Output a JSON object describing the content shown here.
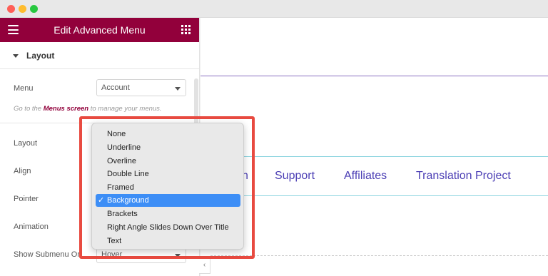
{
  "panel": {
    "title": "Edit Advanced Menu",
    "section": "Layout",
    "menu_label": "Menu",
    "menu_value": "Account",
    "hint_prefix": "Go to the ",
    "hint_link": "Menus screen",
    "hint_suffix": " to manage your menus.",
    "rows": [
      "Layout",
      "Align",
      "Pointer",
      "Animation",
      "Show Submenu On"
    ],
    "submenu_value": "Hover"
  },
  "canvas": {
    "menu_items": [
      "n",
      "Support",
      "Affiliates",
      "Translation Project"
    ]
  },
  "dropdown": {
    "options": [
      "None",
      "Underline",
      "Overline",
      "Double Line",
      "Framed",
      "Background",
      "Brackets",
      "Right Angle Slides Down Over Title",
      "Text"
    ],
    "selected": "Background",
    "check": "✓"
  },
  "colors": {
    "brand": "#92003b",
    "selection": "#3d8ef6",
    "highlight": "#e84a40",
    "menu_text": "#4c3fb5"
  }
}
